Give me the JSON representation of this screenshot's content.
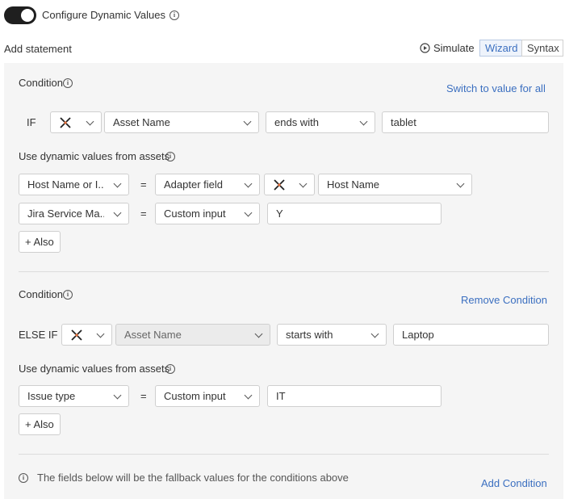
{
  "header": {
    "toggle_label": "Configure Dynamic Values",
    "add_statement": "Add statement",
    "simulate": "Simulate",
    "wizard": "Wizard",
    "syntax": "Syntax"
  },
  "condition1": {
    "title": "Condition",
    "switch_link": "Switch to value for all",
    "keyword": "IF",
    "field": "Asset Name",
    "operator": "ends with",
    "value": "tablet",
    "dynamic_label": "Use dynamic values from assets",
    "rows": [
      {
        "target": "Host Name or I...",
        "eq": "=",
        "source": "Adapter field",
        "adapter_field": "Host Name"
      },
      {
        "target": "Jira Service Ma...",
        "eq": "=",
        "source": "Custom input",
        "value": "Y"
      }
    ],
    "also": "+ Also"
  },
  "condition2": {
    "title": "Condition",
    "remove_link": "Remove Condition",
    "keyword": "ELSE IF",
    "field": "Asset Name",
    "operator": "starts with",
    "value": "Laptop",
    "dynamic_label": "Use dynamic values from assets",
    "rows": [
      {
        "target": "Issue type",
        "eq": "=",
        "source": "Custom input",
        "value": "IT"
      }
    ],
    "also": "+ Also"
  },
  "footer": {
    "fallback_note": "The fields below will be the fallback values for the conditions above",
    "add_condition": "Add Condition"
  },
  "colors": {
    "link": "#3b6fc0",
    "toggle": "#1f1f1f",
    "panel": "#f5f5f5"
  }
}
